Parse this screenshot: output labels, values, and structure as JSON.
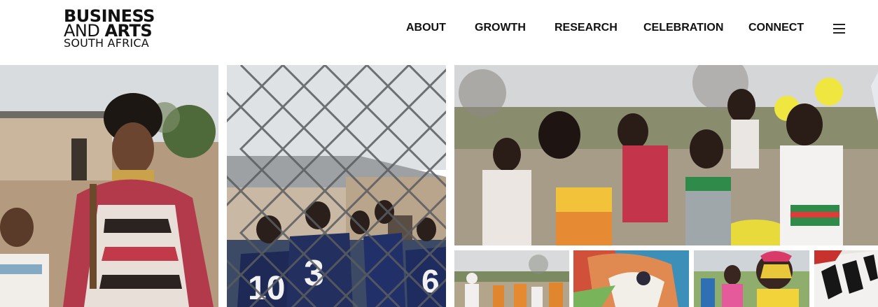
{
  "brand": {
    "line1": "BUSINESS",
    "line2_regular": "AND ",
    "line2_bold": "ARTS",
    "line3": "SOUTH AFRICA"
  },
  "nav": {
    "items": [
      {
        "label": "ABOUT"
      },
      {
        "label": "GROWTH"
      },
      {
        "label": "RESEARCH"
      },
      {
        "label": "CELEBRATION"
      },
      {
        "label": "CONNECT"
      }
    ],
    "menu_icon": "hamburger-menu-icon"
  },
  "gallery": {
    "jersey_numbers": [
      "10",
      "3",
      "6"
    ]
  },
  "colors": {
    "text": "#111111",
    "background": "#ffffff"
  }
}
